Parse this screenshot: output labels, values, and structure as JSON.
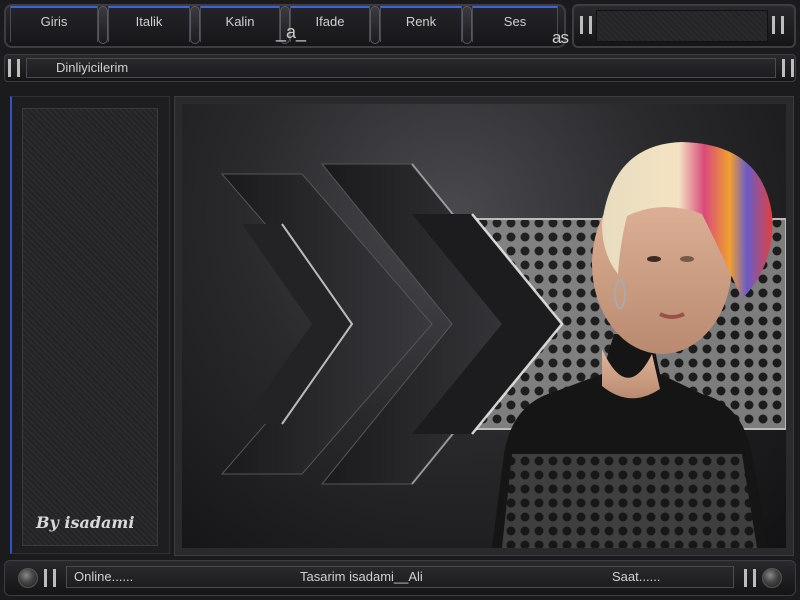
{
  "nav": {
    "tabs": [
      {
        "label": "Giris"
      },
      {
        "label": "Italik"
      },
      {
        "label": "Kalin"
      },
      {
        "label": "Ifade"
      },
      {
        "label": "Renk"
      },
      {
        "label": "Ses"
      }
    ],
    "decor_at": "_a_",
    "decor_as": "as"
  },
  "listeners": {
    "label": "Dinliyicilerim"
  },
  "signature": "By isadami",
  "footer": {
    "online": "Online......",
    "credit": "Tasarim  isadami__Ali",
    "clock": "Saat......"
  },
  "colors": {
    "accent_blue": "#3f63d8",
    "panel_dark": "#1e1e21"
  },
  "icons": {
    "media_control": "pause-icon",
    "knob": "round-knob-icon"
  }
}
